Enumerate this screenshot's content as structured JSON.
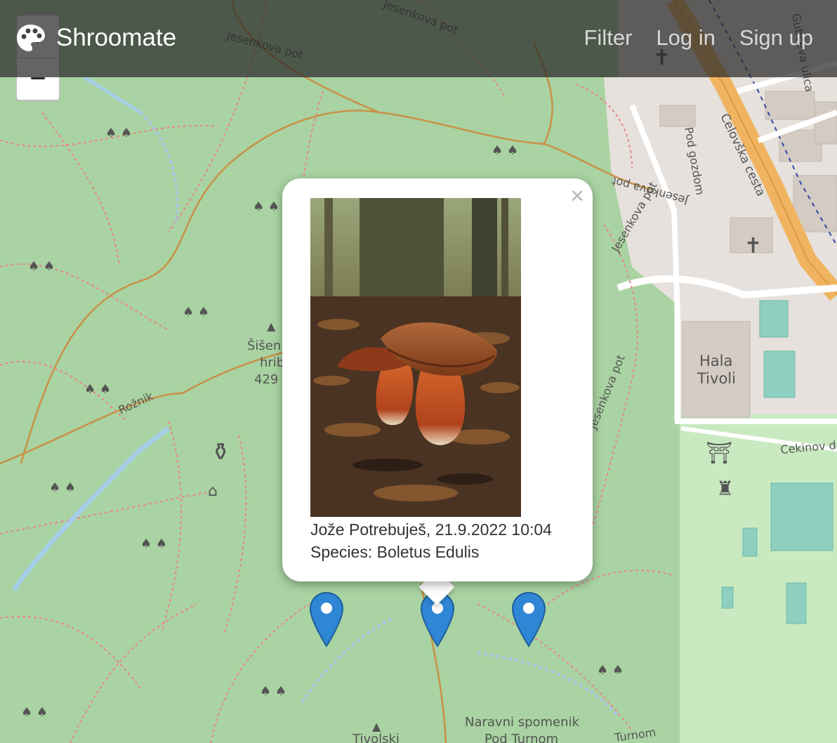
{
  "navbar": {
    "brand": "Shroomate",
    "links": [
      "Filter",
      "Log in",
      "Sign up"
    ]
  },
  "zoom": {
    "in": "+",
    "out": "−"
  },
  "popup": {
    "close": "×",
    "author_date": "Jože Potrebuješ, 21.9.2022 10:04",
    "species": "Species: Boletus Edulis"
  },
  "map_labels": {
    "jesenkova_pot": "Jesenkova pot",
    "pod_gozdom": "Pod gozdom",
    "celovska": "Celovška cesta",
    "gubceva": "Gubčeva ulica",
    "hala1": "Hala",
    "hala2": "Tivoli",
    "sisenski1": "Šišen",
    "sisenski2": "hrib",
    "sisenski3": "429",
    "roznik": "Rožnik",
    "cekinov": "Cekinov d",
    "naravni1": "Naravni spomenik",
    "naravni2": "Pod Turnom",
    "tivolski": "Tivolski",
    "turnom": "Turnom"
  },
  "colors": {
    "forest": "#a9d3a2",
    "marker": "#2f86d4",
    "road": "#f0b461"
  }
}
